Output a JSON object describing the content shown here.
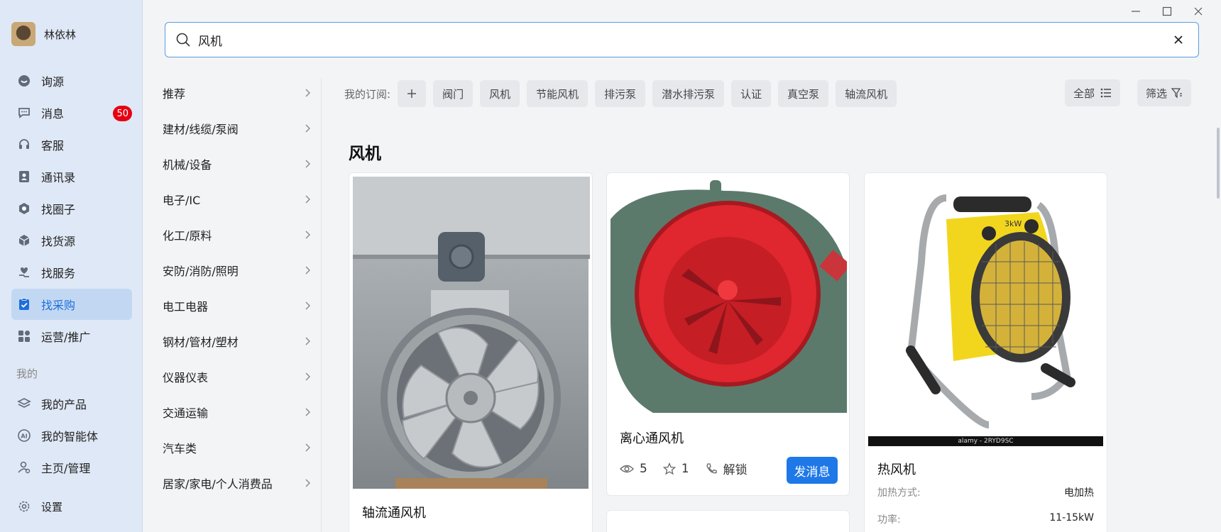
{
  "user": {
    "name": "林依林"
  },
  "nav": [
    {
      "label": "询源",
      "icon": "bubble-icon"
    },
    {
      "label": "消息",
      "icon": "chat-icon",
      "badge": "50"
    },
    {
      "label": "客服",
      "icon": "headset-icon"
    },
    {
      "label": "通讯录",
      "icon": "contacts-icon"
    },
    {
      "label": "找圈子",
      "icon": "hexagon-icon"
    },
    {
      "label": "找货源",
      "icon": "box-icon"
    },
    {
      "label": "找服务",
      "icon": "heart-hand-icon"
    },
    {
      "label": "找采购",
      "icon": "clipboard-check-icon",
      "active": true
    },
    {
      "label": "运营/推广",
      "icon": "grid-icon"
    }
  ],
  "my_section": {
    "label": "我的",
    "items": [
      {
        "label": "我的产品",
        "icon": "layers-icon"
      },
      {
        "label": "我的智能体",
        "icon": "ai-icon"
      },
      {
        "label": "主页/管理",
        "icon": "user-gear-icon"
      }
    ]
  },
  "settings": {
    "label": "设置",
    "icon": "gear-icon"
  },
  "search": {
    "value": "风机"
  },
  "categories": [
    "推荐",
    "建材/线缆/泵阀",
    "机械/设备",
    "电子/IC",
    "化工/原料",
    "安防/消防/照明",
    "电工电器",
    "钢材/管材/塑材",
    "仪器仪表",
    "交通运输",
    "汽车类",
    "居家/家电/个人消费品"
  ],
  "subscriptions": {
    "label": "我的订阅:",
    "add_symbol": "+",
    "tags": [
      "阀门",
      "风机",
      "节能风机",
      "排污泵",
      "潜水排污泵",
      "认证",
      "真空泵",
      "轴流风机"
    ],
    "all_label": "全部",
    "filter_label": "筛选"
  },
  "section_title": "风机",
  "cards": [
    {
      "title": "轴流通风机"
    },
    {
      "title": "离心通风机",
      "views": "5",
      "stars": "1",
      "unlock_label": "解锁",
      "send_label": "发消息"
    },
    {
      "title": "热风机",
      "watermark": "alamy - 2RYD9SC",
      "attrs": [
        {
          "key": "加热方式:",
          "value": "电加热"
        },
        {
          "key": "功率:",
          "value": "11-15kW"
        }
      ]
    }
  ],
  "colors": {
    "accent": "#1e78e8",
    "sidebar_bg": "#dfe8f6",
    "active_bg": "#c2d8f2",
    "badge": "#e60012"
  }
}
